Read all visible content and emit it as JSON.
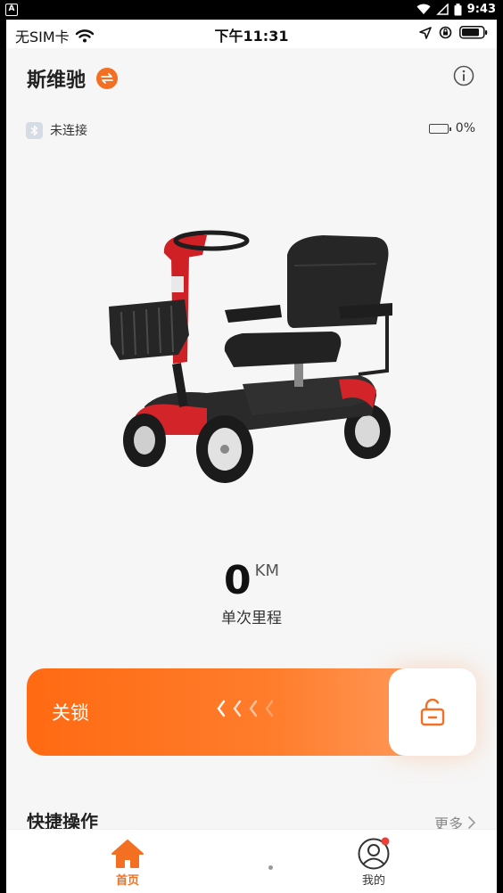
{
  "android_status": {
    "badge": "A",
    "time": "9:43"
  },
  "ios_status": {
    "carrier": "无SIM卡",
    "time": "下午11:31"
  },
  "header": {
    "title": "斯维驰"
  },
  "connection": {
    "status": "未连接"
  },
  "battery": {
    "percent_text": "0%"
  },
  "trip": {
    "distance": "0",
    "unit": "KM",
    "label": "单次里程"
  },
  "lock_slider": {
    "label": "关锁"
  },
  "quick_ops": {
    "title": "快捷操作",
    "more": "更多"
  },
  "tabbar": {
    "home": "首页",
    "me": "我的"
  },
  "colors": {
    "accent": "#f36f21",
    "scooter_red": "#d3242a",
    "badge_red": "#e8413a"
  }
}
